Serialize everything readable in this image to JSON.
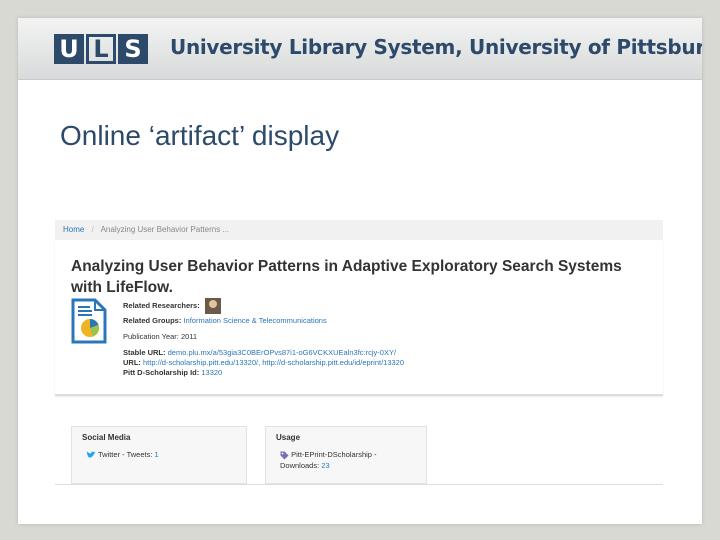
{
  "banner": {
    "logo_letters": [
      "U",
      "L",
      "S"
    ],
    "title": "University Library System, University of Pittsburgh"
  },
  "slide": {
    "title": "Online ‘artifact’ display"
  },
  "breadcrumb": {
    "home": "Home",
    "separator": "/",
    "current": "Analyzing User Behavior Patterns ..."
  },
  "record": {
    "title": "Analyzing User Behavior Patterns in Adaptive Exploratory Search Systems with LifeFlow.",
    "related_researchers_label": "Related Researchers:",
    "related_groups_label": "Related Groups:",
    "related_groups_value": "Information Science & Telecommunications",
    "publication_year": "Publication Year: 2011",
    "stable_url_label": "Stable URL:",
    "stable_url_value": "demo.plu.mx/a/53gia3C0BErOPvs87i1-oG6VCKXUEaln3fc:rcjy-0XY/",
    "url_label": "URL:",
    "url_value": "http://d-scholarship.pitt.edu/13320/, http://d-scholarship.pitt.edu/id/eprint/13320",
    "dscholarship_label": "Pitt D-Scholarship Id:",
    "dscholarship_value": "13320"
  },
  "panels": {
    "social": {
      "title": "Social Media",
      "item": "Twitter - Tweets: ",
      "count": "1"
    },
    "usage": {
      "title": "Usage",
      "item_line1": "Pitt-EPrint-DScholarship -",
      "item_line2": "Downloads: ",
      "count": "23"
    }
  },
  "colors": {
    "brand": "#2d4a6a",
    "link": "#2a76b8",
    "twitter": "#1da1f2",
    "tag": "#7a6fb0"
  }
}
